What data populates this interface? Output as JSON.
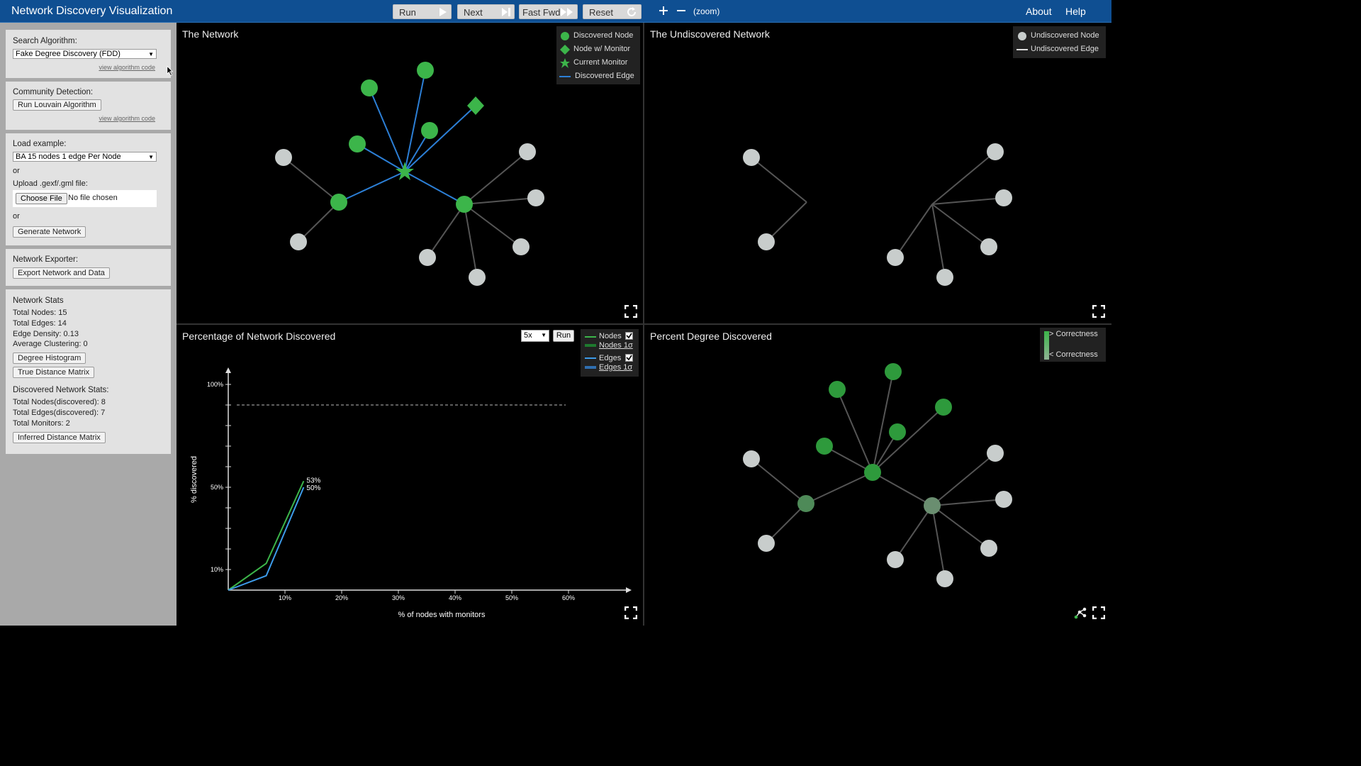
{
  "app": {
    "title": "Network Discovery Visualization"
  },
  "toolbar": {
    "run": "Run",
    "next": "Next",
    "fast_fwd": "Fast Fwd",
    "reset": "Reset",
    "zoom_label": "(zoom)",
    "about": "About",
    "help": "Help"
  },
  "sidebar": {
    "search": {
      "title": "Search Algorithm:",
      "selected": "Fake Degree Discovery (FDD)",
      "code_link": "view algorithm code"
    },
    "community": {
      "title": "Community Detection:",
      "button": "Run Louvain Algorithm",
      "code_link": "view algorithm code"
    },
    "load": {
      "title": "Load example:",
      "selected": "BA 15 nodes 1 edge Per Node",
      "or1": "or",
      "upload_label": "Upload .gexf/.gml file:",
      "choose_file": "Choose File",
      "no_file": "No file chosen",
      "or2": "or",
      "generate": "Generate Network"
    },
    "exporter": {
      "title": "Network Exporter:",
      "button": "Export Network and Data"
    },
    "stats": {
      "title": "Network Stats",
      "total_nodes": "Total Nodes: 15",
      "total_edges": "Total Edges: 14",
      "edge_density": "Edge Density: 0.13",
      "avg_clustering": "Average Clustering: 0",
      "degree_histogram": "Degree Histogram",
      "true_distance": "True Distance Matrix",
      "discovered_title": "Discovered Network Stats:",
      "nodes_discovered": "Total Nodes(discovered): 8",
      "edges_discovered": "Total Edges(discovered): 7",
      "monitors": "Total Monitors: 2",
      "inferred_distance": "Inferred Distance Matrix"
    }
  },
  "panels": {
    "network": {
      "title": "The Network",
      "legend": [
        "Discovered Node",
        "Node w/ Monitor",
        "Current Monitor",
        "Discovered Edge"
      ]
    },
    "undiscovered": {
      "title": "The Undiscovered Network",
      "legend": [
        "Undiscovered Node",
        "Undiscovered Edge"
      ]
    },
    "percentage": {
      "title": "Percentage of Network Discovered",
      "speed": "5x",
      "run": "Run",
      "legend": [
        "Nodes",
        "Nodes 1σ",
        "Edges",
        "Edges 1σ"
      ]
    },
    "degree": {
      "title": "Percent Degree Discovered",
      "legend": [
        "> Correctness",
        "< Correctness"
      ]
    }
  },
  "colors": {
    "discovered": "#3cb54a",
    "undiscovered": "#c8cdcc",
    "edge_discovered": "#2c7fd6",
    "edge_undiscovered": "#555555",
    "nodes_line": "#3cb54a",
    "edges_line": "#3d9be9"
  },
  "chart_data": {
    "type": "line",
    "xlabel": "% of nodes with monitors",
    "ylabel": "% discovered",
    "x_ticks": [
      "10%",
      "20%",
      "30%",
      "40%",
      "50%",
      "60%"
    ],
    "y_ticks": [
      "10%",
      "50%",
      "100%"
    ],
    "xlim": [
      0,
      70
    ],
    "ylim": [
      0,
      100
    ],
    "reference_line": 90,
    "series": [
      {
        "name": "Nodes",
        "x": [
          0,
          6.7,
          13.3
        ],
        "y": [
          0,
          13,
          53
        ],
        "end_label": "53%"
      },
      {
        "name": "Edges",
        "x": [
          0,
          6.7,
          13.3
        ],
        "y": [
          0,
          7,
          50
        ],
        "end_label": "50%"
      }
    ]
  }
}
